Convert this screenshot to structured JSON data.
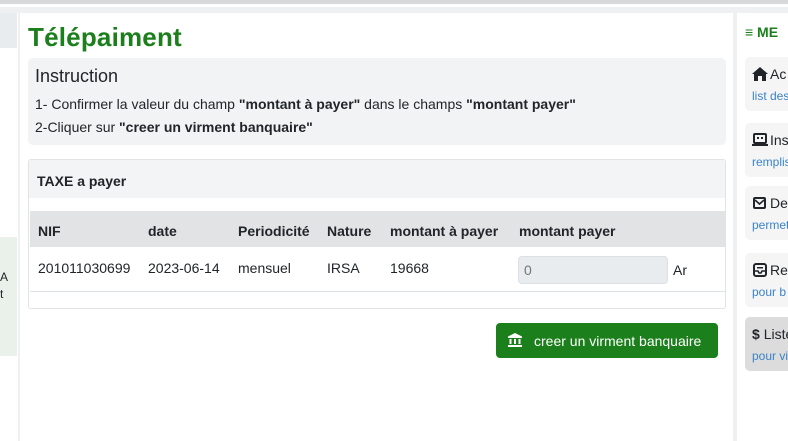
{
  "main": {
    "title": "Télépaiment",
    "instruction": {
      "title": "Instruction",
      "line1": {
        "prefix": "1- Confirmer la valeur du champ ",
        "field1": "\"montant à payer\"",
        "middle": " dans le champs ",
        "field2": "\"montant payer\""
      },
      "line2": {
        "prefix": "2-Cliquer sur ",
        "action": "\"creer un virment banquaire\""
      }
    },
    "tax_card": {
      "header": "TAXE a payer",
      "columns": [
        "NIF",
        "date",
        "Periodicité",
        "Nature",
        "montant à payer",
        "montant payer"
      ],
      "row": {
        "nif": "201011030699",
        "date": "2023-06-14",
        "periodicite": "mensuel",
        "nature": "IRSA",
        "montant_a_payer": "19668",
        "montant_payer_placeholder": "0",
        "currency": "Ar"
      }
    },
    "create_button": {
      "label": "creer un virment banquaire",
      "icon": "bank-icon"
    }
  },
  "left_panel": {
    "fragment1": "A",
    "fragment2": "t"
  },
  "menu": {
    "header": "≡ ME",
    "items": [
      {
        "title": "Ac",
        "desc": "list des",
        "icon": "home-icon"
      },
      {
        "title": "Ins",
        "desc": "remplis",
        "icon": "laptop-icon"
      },
      {
        "title": "Dec",
        "desc": "permet",
        "icon": "envelope-icon"
      },
      {
        "title": "Rec",
        "desc": "pour b",
        "icon": "inbox-icon"
      },
      {
        "title": "Liste",
        "desc": "pour vi",
        "icon": "dollar-icon"
      }
    ]
  },
  "colors": {
    "brand_green": "#1b7f1b",
    "link_blue": "#3a83c9"
  }
}
